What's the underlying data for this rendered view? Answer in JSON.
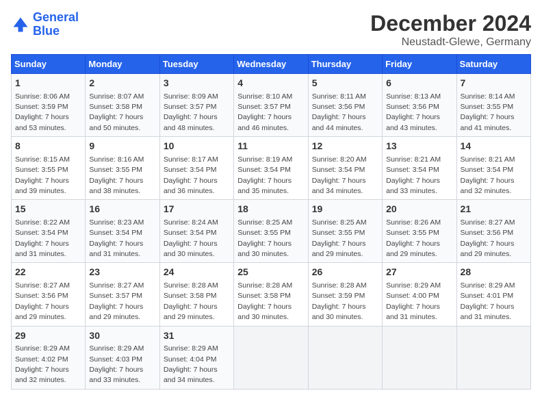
{
  "header": {
    "logo_line1": "General",
    "logo_line2": "Blue",
    "title": "December 2024",
    "subtitle": "Neustadt-Glewe, Germany"
  },
  "calendar": {
    "days_of_week": [
      "Sunday",
      "Monday",
      "Tuesday",
      "Wednesday",
      "Thursday",
      "Friday",
      "Saturday"
    ],
    "weeks": [
      [
        {
          "day": "1",
          "sunrise": "8:06 AM",
          "sunset": "3:59 PM",
          "daylight": "7 hours and 53 minutes."
        },
        {
          "day": "2",
          "sunrise": "8:07 AM",
          "sunset": "3:58 PM",
          "daylight": "7 hours and 50 minutes."
        },
        {
          "day": "3",
          "sunrise": "8:09 AM",
          "sunset": "3:57 PM",
          "daylight": "7 hours and 48 minutes."
        },
        {
          "day": "4",
          "sunrise": "8:10 AM",
          "sunset": "3:57 PM",
          "daylight": "7 hours and 46 minutes."
        },
        {
          "day": "5",
          "sunrise": "8:11 AM",
          "sunset": "3:56 PM",
          "daylight": "7 hours and 44 minutes."
        },
        {
          "day": "6",
          "sunrise": "8:13 AM",
          "sunset": "3:56 PM",
          "daylight": "7 hours and 43 minutes."
        },
        {
          "day": "7",
          "sunrise": "8:14 AM",
          "sunset": "3:55 PM",
          "daylight": "7 hours and 41 minutes."
        }
      ],
      [
        {
          "day": "8",
          "sunrise": "8:15 AM",
          "sunset": "3:55 PM",
          "daylight": "7 hours and 39 minutes."
        },
        {
          "day": "9",
          "sunrise": "8:16 AM",
          "sunset": "3:55 PM",
          "daylight": "7 hours and 38 minutes."
        },
        {
          "day": "10",
          "sunrise": "8:17 AM",
          "sunset": "3:54 PM",
          "daylight": "7 hours and 36 minutes."
        },
        {
          "day": "11",
          "sunrise": "8:19 AM",
          "sunset": "3:54 PM",
          "daylight": "7 hours and 35 minutes."
        },
        {
          "day": "12",
          "sunrise": "8:20 AM",
          "sunset": "3:54 PM",
          "daylight": "7 hours and 34 minutes."
        },
        {
          "day": "13",
          "sunrise": "8:21 AM",
          "sunset": "3:54 PM",
          "daylight": "7 hours and 33 minutes."
        },
        {
          "day": "14",
          "sunrise": "8:21 AM",
          "sunset": "3:54 PM",
          "daylight": "7 hours and 32 minutes."
        }
      ],
      [
        {
          "day": "15",
          "sunrise": "8:22 AM",
          "sunset": "3:54 PM",
          "daylight": "7 hours and 31 minutes."
        },
        {
          "day": "16",
          "sunrise": "8:23 AM",
          "sunset": "3:54 PM",
          "daylight": "7 hours and 31 minutes."
        },
        {
          "day": "17",
          "sunrise": "8:24 AM",
          "sunset": "3:54 PM",
          "daylight": "7 hours and 30 minutes."
        },
        {
          "day": "18",
          "sunrise": "8:25 AM",
          "sunset": "3:55 PM",
          "daylight": "7 hours and 30 minutes."
        },
        {
          "day": "19",
          "sunrise": "8:25 AM",
          "sunset": "3:55 PM",
          "daylight": "7 hours and 29 minutes."
        },
        {
          "day": "20",
          "sunrise": "8:26 AM",
          "sunset": "3:55 PM",
          "daylight": "7 hours and 29 minutes."
        },
        {
          "day": "21",
          "sunrise": "8:27 AM",
          "sunset": "3:56 PM",
          "daylight": "7 hours and 29 minutes."
        }
      ],
      [
        {
          "day": "22",
          "sunrise": "8:27 AM",
          "sunset": "3:56 PM",
          "daylight": "7 hours and 29 minutes."
        },
        {
          "day": "23",
          "sunrise": "8:27 AM",
          "sunset": "3:57 PM",
          "daylight": "7 hours and 29 minutes."
        },
        {
          "day": "24",
          "sunrise": "8:28 AM",
          "sunset": "3:58 PM",
          "daylight": "7 hours and 29 minutes."
        },
        {
          "day": "25",
          "sunrise": "8:28 AM",
          "sunset": "3:58 PM",
          "daylight": "7 hours and 30 minutes."
        },
        {
          "day": "26",
          "sunrise": "8:28 AM",
          "sunset": "3:59 PM",
          "daylight": "7 hours and 30 minutes."
        },
        {
          "day": "27",
          "sunrise": "8:29 AM",
          "sunset": "4:00 PM",
          "daylight": "7 hours and 31 minutes."
        },
        {
          "day": "28",
          "sunrise": "8:29 AM",
          "sunset": "4:01 PM",
          "daylight": "7 hours and 31 minutes."
        }
      ],
      [
        {
          "day": "29",
          "sunrise": "8:29 AM",
          "sunset": "4:02 PM",
          "daylight": "7 hours and 32 minutes."
        },
        {
          "day": "30",
          "sunrise": "8:29 AM",
          "sunset": "4:03 PM",
          "daylight": "7 hours and 33 minutes."
        },
        {
          "day": "31",
          "sunrise": "8:29 AM",
          "sunset": "4:04 PM",
          "daylight": "7 hours and 34 minutes."
        },
        null,
        null,
        null,
        null
      ]
    ]
  }
}
